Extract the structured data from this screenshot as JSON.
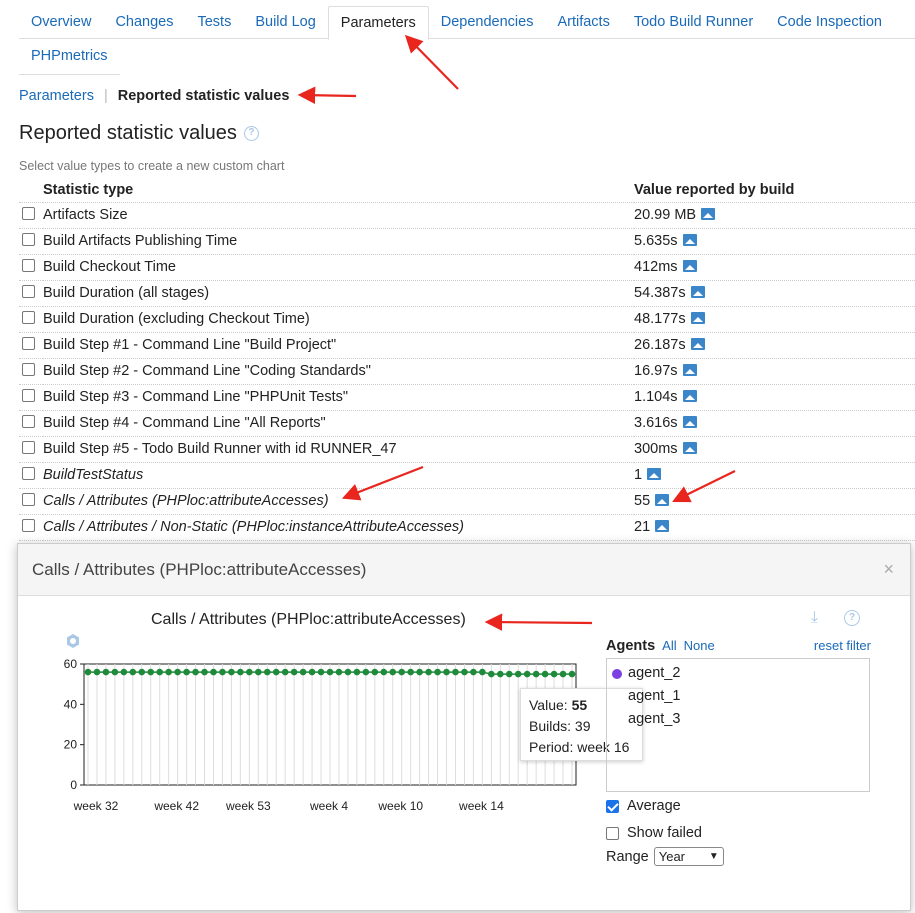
{
  "tabs": [
    "Overview",
    "Changes",
    "Tests",
    "Build Log",
    "Parameters",
    "Dependencies",
    "Artifacts",
    "Todo Build Runner",
    "Code Inspection"
  ],
  "tabs_second_row": [
    "PHPmetrics"
  ],
  "breadcrumb": {
    "parent": "Parameters",
    "separator": "|",
    "current": "Reported statistic values"
  },
  "page_title": "Reported statistic values",
  "hint": "Select value types to create a new custom chart",
  "table": {
    "headers": [
      "Statistic type",
      "Value reported by build"
    ],
    "rows": [
      {
        "name": "Artifacts Size",
        "value": "20.99 MB",
        "italic": false
      },
      {
        "name": "Build Artifacts Publishing Time",
        "value": "5.635s",
        "italic": false
      },
      {
        "name": "Build Checkout Time",
        "value": "412ms",
        "italic": false
      },
      {
        "name": "Build Duration (all stages)",
        "value": "54.387s",
        "italic": false
      },
      {
        "name": "Build Duration (excluding Checkout Time)",
        "value": "48.177s",
        "italic": false
      },
      {
        "name": "Build Step #1 - Command Line \"Build Project\"",
        "value": "26.187s",
        "italic": false
      },
      {
        "name": "Build Step #2 - Command Line \"Coding Standards\"",
        "value": "16.97s",
        "italic": false
      },
      {
        "name": "Build Step #3 - Command Line \"PHPUnit Tests\"",
        "value": "1.104s",
        "italic": false
      },
      {
        "name": "Build Step #4 - Command Line \"All Reports\"",
        "value": "3.616s",
        "italic": false
      },
      {
        "name": "Build Step #5 - Todo Build Runner with id RUNNER_47",
        "value": "300ms",
        "italic": false
      },
      {
        "name": "BuildTestStatus",
        "value": "1",
        "italic": true
      },
      {
        "name": "Calls / Attributes (PHPloc:attributeAccesses)",
        "value": "55",
        "italic": true
      },
      {
        "name": "Calls / Attributes / Non-Static (PHPloc:instanceAttributeAccesses)",
        "value": "21",
        "italic": true
      }
    ]
  },
  "dialog": {
    "title": "Calls / Attributes (PHPloc:attributeAccesses)",
    "close": "×",
    "chart_title": "Calls / Attributes (PHPloc:attributeAccesses)",
    "agents_label": "Agents",
    "all_link": "All",
    "none_link": "None",
    "reset_link": "reset filter",
    "agents": [
      {
        "name": "agent_2",
        "color": "#7b3fe4"
      },
      {
        "name": "agent_1",
        "color": ""
      },
      {
        "name": "agent_3",
        "color": ""
      }
    ],
    "average_label": "Average",
    "show_failed_label": "Show failed",
    "range_label": "Range",
    "range_value": "Year",
    "tooltip": {
      "value_label": "Value:",
      "value": "55",
      "builds_label": "Builds:",
      "builds": "39",
      "period_label": "Period:",
      "period": "week 16"
    }
  },
  "chart_data": {
    "type": "scatter",
    "title": "Calls / Attributes (PHPloc:attributeAccesses)",
    "xlabel": "",
    "ylabel": "",
    "ylim": [
      0,
      60
    ],
    "yticks": [
      0,
      20,
      40,
      60
    ],
    "xtick_labels": [
      "week 32",
      "week 42",
      "week 53",
      "week 4",
      "week 10",
      "week 14"
    ],
    "x": [
      1,
      2,
      3,
      4,
      5,
      6,
      7,
      8,
      9,
      10,
      11,
      12,
      13,
      14,
      15,
      16,
      17,
      18,
      19,
      20,
      21,
      22,
      23,
      24,
      25,
      26,
      27,
      28,
      29,
      30,
      31,
      32,
      33,
      34,
      35,
      36,
      37,
      38,
      39,
      40,
      41,
      42,
      43,
      44,
      45,
      46,
      47,
      48,
      49,
      50,
      51,
      52,
      53,
      54,
      55
    ],
    "y": [
      56,
      56,
      56,
      56,
      56,
      56,
      56,
      56,
      56,
      56,
      56,
      56,
      56,
      56,
      56,
      56,
      56,
      56,
      56,
      56,
      56,
      56,
      56,
      56,
      56,
      56,
      56,
      56,
      56,
      56,
      56,
      56,
      56,
      56,
      56,
      56,
      56,
      56,
      56,
      56,
      56,
      56,
      56,
      56,
      56,
      55,
      55,
      55,
      55,
      55,
      55,
      55,
      55,
      55,
      55
    ],
    "series_color": "#1e8a3a",
    "grid": true
  },
  "colors": {
    "link": "#1a6ab8",
    "accent_icon": "#3b86c9",
    "annotation_arrow": "#e8261e"
  }
}
